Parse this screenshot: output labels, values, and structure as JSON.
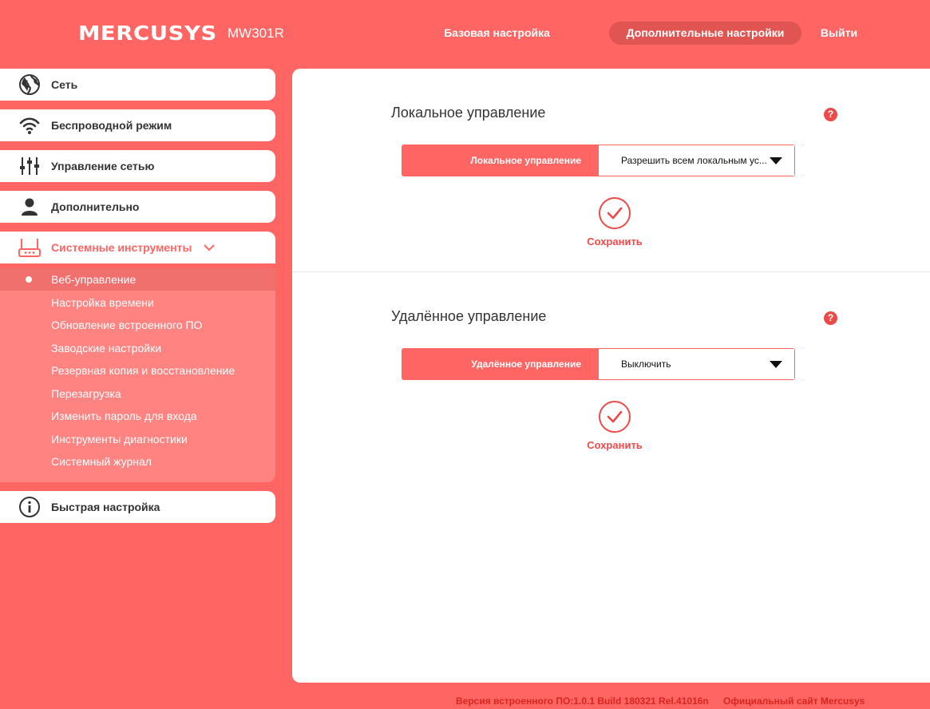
{
  "header": {
    "brand": "MERCUSYS",
    "model": "MW301R",
    "nav": {
      "basic": "Базовая настройка",
      "advanced": "Дополнительные настройки",
      "logout": "Выйти"
    }
  },
  "sidebar": {
    "items": [
      {
        "label": "Сеть",
        "icon": "globe-icon"
      },
      {
        "label": "Беспроводной режим",
        "icon": "wifi-icon"
      },
      {
        "label": "Управление сетью",
        "icon": "sliders-icon"
      },
      {
        "label": "Дополнительно",
        "icon": "user-icon"
      },
      {
        "label": "Системные инструменты",
        "icon": "router-icon",
        "expanded": true
      },
      {
        "label": "Быстрая настройка",
        "icon": "info-icon"
      }
    ],
    "submenu": [
      {
        "label": "Веб-управление",
        "selected": true
      },
      {
        "label": "Настройка времени"
      },
      {
        "label": "Обновление встроенного ПО"
      },
      {
        "label": "Заводские настройки"
      },
      {
        "label": "Резервная копия и восстановление"
      },
      {
        "label": "Перезагрузка"
      },
      {
        "label": "Изменить пароль для входа"
      },
      {
        "label": "Инструменты диагностики"
      },
      {
        "label": "Системный журнал"
      }
    ]
  },
  "local": {
    "title": "Локальное управление",
    "field_label": "Локальное управление",
    "field_value": "Разрешить всем локальным ус...",
    "save": "Сохранить"
  },
  "remote": {
    "title": "Удалённое управление",
    "field_label": "Удалённое управление",
    "field_value": "Выключить",
    "save": "Сохранить"
  },
  "help_glyph": "?",
  "footer": {
    "version": "Версия встроенного ПО:1.0.1 Build 180321 Rel.41016n",
    "site": "Официальный сайт Mercusys"
  },
  "colors": {
    "brand": "#ff6563",
    "accent_dark": "#e05452",
    "submenu_bg": "#ff8380",
    "footer_text": "#d7261f"
  }
}
